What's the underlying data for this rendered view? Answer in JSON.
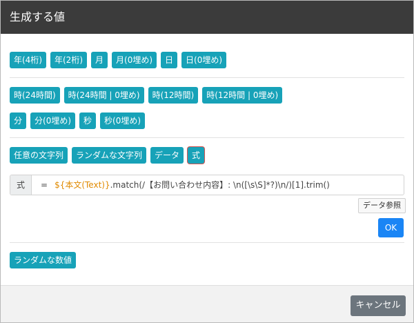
{
  "dialog": {
    "title": "生成する値"
  },
  "date_buttons": [
    "年(4桁)",
    "年(2桁)",
    "月",
    "月(0埋め)",
    "日",
    "日(0埋め)"
  ],
  "hour_buttons": [
    "時(24時間)",
    "時(24時間 | 0埋め)",
    "時(12時間)",
    "時(12時間 | 0埋め)"
  ],
  "minute_second_buttons": [
    "分",
    "分(0埋め)",
    "秒",
    "秒(0埋め)"
  ],
  "other_buttons": [
    "任意の文字列",
    "ランダムな文字列",
    "データ",
    "式"
  ],
  "formula": {
    "label": "式",
    "eq": "=",
    "field_token": "${本文(Text)}",
    "rest": ".match(/【お問い合わせ内容】: \\n([\\s\\S]*?)\\n/)[1].trim()"
  },
  "data_ref_label": "データ参照",
  "ok_label": "OK",
  "random_number_label": "ランダムな数値",
  "cancel_label": "キャンセル",
  "colors": {
    "chip": "#17a2b8",
    "header": "#3b3b3b",
    "ok": "#1a85f5",
    "cancel": "#6c757d",
    "field_token": "#e08a00"
  }
}
